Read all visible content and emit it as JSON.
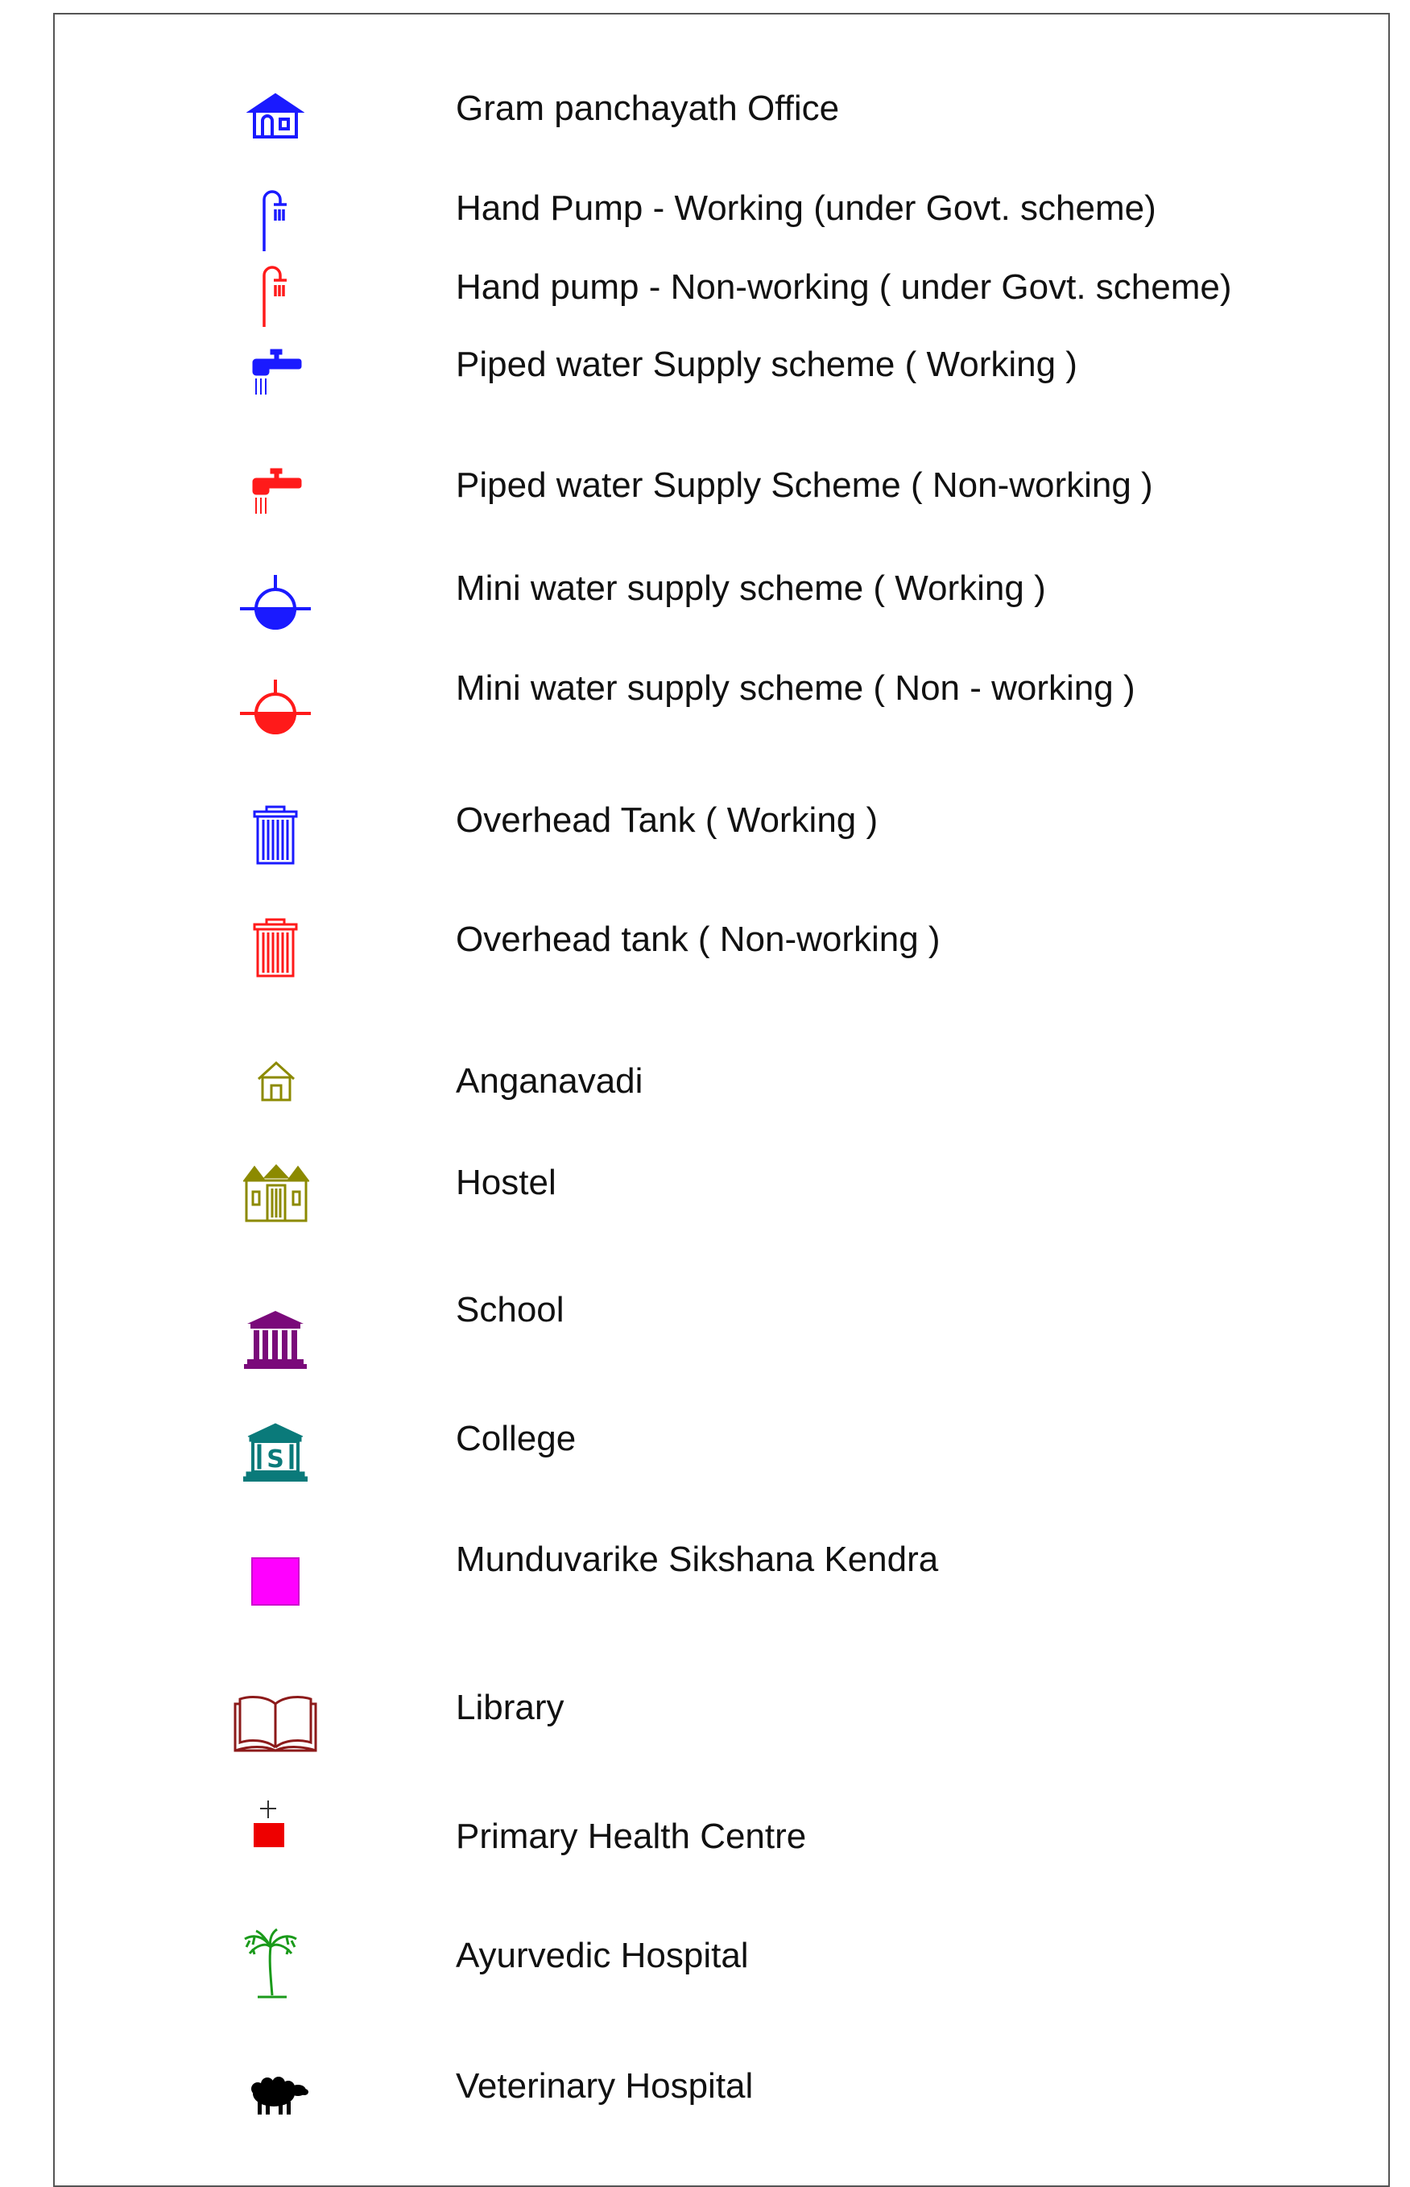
{
  "legend": {
    "items": [
      {
        "icon": "gram-panchayath-office-icon",
        "color": "#1a1aff",
        "label": "Gram panchayath Office"
      },
      {
        "icon": "hand-pump-icon",
        "color": "#1a1aff",
        "label": "Hand Pump - Working  (under Govt. scheme)"
      },
      {
        "icon": "hand-pump-icon",
        "color": "#ff1a1a",
        "label": "Hand pump - Non-working  ( under Govt. scheme)"
      },
      {
        "icon": "tap-icon",
        "color": "#1a1aff",
        "label": "Piped water Supply scheme ( Working )"
      },
      {
        "icon": "tap-icon",
        "color": "#ff1a1a",
        "label": "Piped water Supply Scheme ( Non-working )"
      },
      {
        "icon": "mini-water-supply-icon",
        "color": "#1a1aff",
        "label": "Mini water supply scheme ( Working )"
      },
      {
        "icon": "mini-water-supply-icon",
        "color": "#ff1a1a",
        "label": " Mini water supply scheme ( Non - working )"
      },
      {
        "icon": "overhead-tank-icon",
        "color": "#1a1aff",
        "label": "Overhead Tank ( Working )"
      },
      {
        "icon": "overhead-tank-icon",
        "color": "#ff1a1a",
        "label": "Overhead tank ( Non-working )"
      },
      {
        "icon": "anganavadi-house-icon",
        "color": "#8c8a00",
        "label": "Anganavadi"
      },
      {
        "icon": "hostel-icon",
        "color": "#8c8a00",
        "label": "Hostel"
      },
      {
        "icon": "school-icon",
        "color": "#7a0a7a",
        "label": "School"
      },
      {
        "icon": "college-icon",
        "color": "#0a7a7a",
        "label": "College"
      },
      {
        "icon": "magenta-square-icon",
        "color": "#ff00ff",
        "label": "Munduvarike Sikshana Kendra"
      },
      {
        "icon": "library-book-icon",
        "color": "#8c1a1a",
        "label": "Library"
      },
      {
        "icon": "health-centre-icon",
        "color": "#ee0000",
        "label": "Primary Health Centre"
      },
      {
        "icon": "palm-tree-icon",
        "color": "#1a9a1a",
        "label": " Ayurvedic Hospital"
      },
      {
        "icon": "sheep-icon",
        "color": "#000000",
        "label": " Veterinary Hospital"
      }
    ]
  }
}
